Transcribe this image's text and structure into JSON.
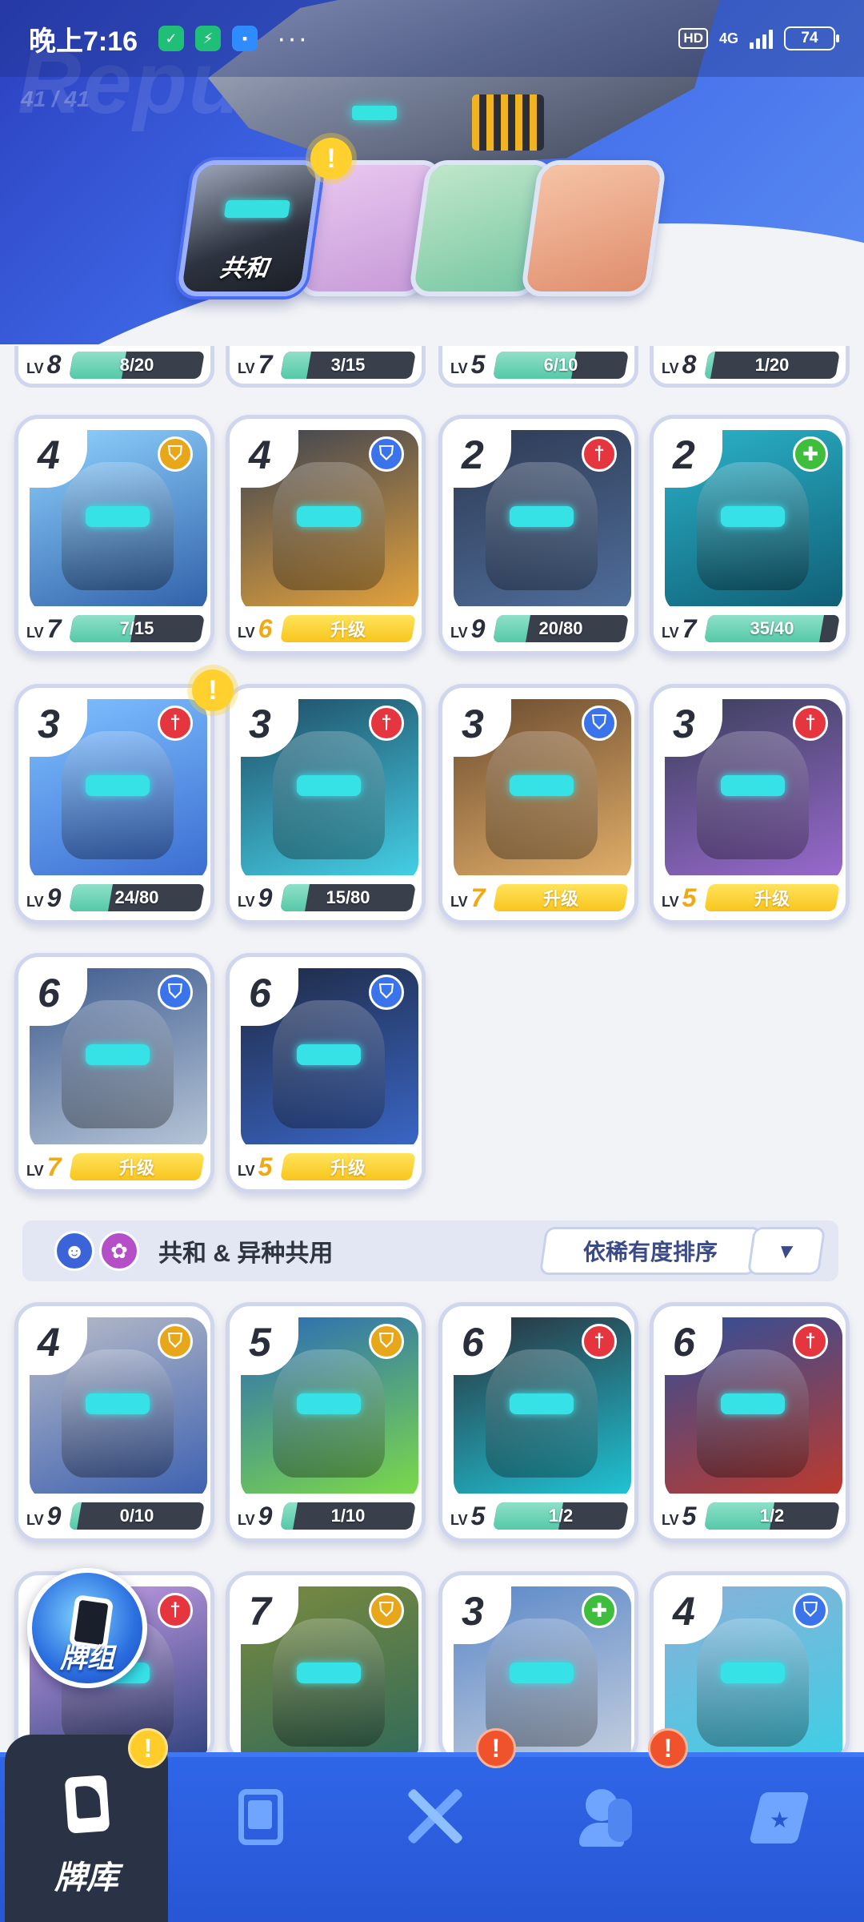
{
  "status_bar": {
    "time": "晚上7:16",
    "hd": "HD",
    "network": "4G",
    "battery": "74",
    "more": "···"
  },
  "header": {
    "bg_text": "Repu",
    "card_count": "41 / 41"
  },
  "faction_tabs": [
    {
      "label": "共和",
      "active": true,
      "has_alert": true
    },
    {
      "label": "",
      "active": false
    },
    {
      "label": "",
      "active": false
    },
    {
      "label": "",
      "active": false
    }
  ],
  "partial_row": [
    {
      "lv": "8",
      "progress": "8/20"
    },
    {
      "lv": "7",
      "progress": "3/15"
    },
    {
      "lv": "5",
      "progress": "6/10"
    },
    {
      "lv": "8",
      "progress": "1/20"
    }
  ],
  "republic_cards": [
    {
      "cost": "4",
      "role": "gold",
      "role_icon": "shield-icon",
      "lv": "7",
      "progress": "7/15",
      "upgrade": false
    },
    {
      "cost": "4",
      "role": "blue",
      "role_icon": "shield-icon",
      "lv": "6",
      "progress": "升级",
      "upgrade": true
    },
    {
      "cost": "2",
      "role": "red",
      "role_icon": "sword-icon",
      "lv": "9",
      "progress": "20/80",
      "upgrade": false
    },
    {
      "cost": "2",
      "role": "green",
      "role_icon": "plus-icon",
      "lv": "7",
      "progress": "35/40",
      "upgrade": false
    },
    {
      "cost": "3",
      "role": "red",
      "role_icon": "sword-icon",
      "lv": "9",
      "progress": "24/80",
      "upgrade": false,
      "has_alert": true
    },
    {
      "cost": "3",
      "role": "red",
      "role_icon": "sword-icon",
      "lv": "9",
      "progress": "15/80",
      "upgrade": false
    },
    {
      "cost": "3",
      "role": "blue",
      "role_icon": "shield-icon",
      "lv": "7",
      "progress": "升级",
      "upgrade": true
    },
    {
      "cost": "3",
      "role": "red",
      "role_icon": "sword-icon",
      "lv": "5",
      "progress": "升级",
      "upgrade": true
    },
    {
      "cost": "6",
      "role": "blue",
      "role_icon": "shield-icon",
      "lv": "7",
      "progress": "升级",
      "upgrade": true
    },
    {
      "cost": "6",
      "role": "blue",
      "role_icon": "shield-icon",
      "lv": "5",
      "progress": "升级",
      "upgrade": true
    }
  ],
  "shared_section": {
    "label": "共和 & 异种共用",
    "sort_label": "依稀有度排序",
    "sort_toggle": "▼"
  },
  "shared_cards": [
    {
      "cost": "4",
      "role": "gold",
      "role_icon": "shield-icon",
      "lv": "9",
      "progress": "0/10",
      "upgrade": false
    },
    {
      "cost": "5",
      "role": "gold",
      "role_icon": "shield-icon",
      "lv": "9",
      "progress": "1/10",
      "upgrade": false
    },
    {
      "cost": "6",
      "role": "red",
      "role_icon": "sword-icon",
      "lv": "5",
      "progress": "1/2",
      "upgrade": false
    },
    {
      "cost": "6",
      "role": "red",
      "role_icon": "sword-icon",
      "lv": "5",
      "progress": "1/2",
      "upgrade": false
    }
  ],
  "bottom_row_cards": [
    {
      "cost": "",
      "role": "red",
      "role_icon": "sword-icon"
    },
    {
      "cost": "7",
      "role": "gold",
      "role_icon": "shield-icon"
    },
    {
      "cost": "3",
      "role": "green",
      "role_icon": "plus-icon"
    },
    {
      "cost": "4",
      "role": "blue",
      "role_icon": "shield-icon"
    }
  ],
  "deck_button": {
    "label": "牌组"
  },
  "bottom_nav": [
    {
      "label": "牌库",
      "icon": "card-library-icon",
      "active": true,
      "alert": "!"
    },
    {
      "label": "",
      "icon": "shop-icon",
      "active": false,
      "alert": ""
    },
    {
      "label": "",
      "icon": "battle-swords-icon",
      "active": false,
      "alert": "!"
    },
    {
      "label": "",
      "icon": "friends-icon",
      "active": false,
      "alert": "!"
    },
    {
      "label": "",
      "icon": "battle-pass-icon",
      "active": false,
      "alert": ""
    }
  ],
  "colors": {
    "accent_blue": "#2f66e8",
    "progress_green": "#55c9a8",
    "upgrade_yellow": "#f8c51e",
    "alert_yellow": "#ffd02e",
    "alert_red": "#f0522c"
  }
}
